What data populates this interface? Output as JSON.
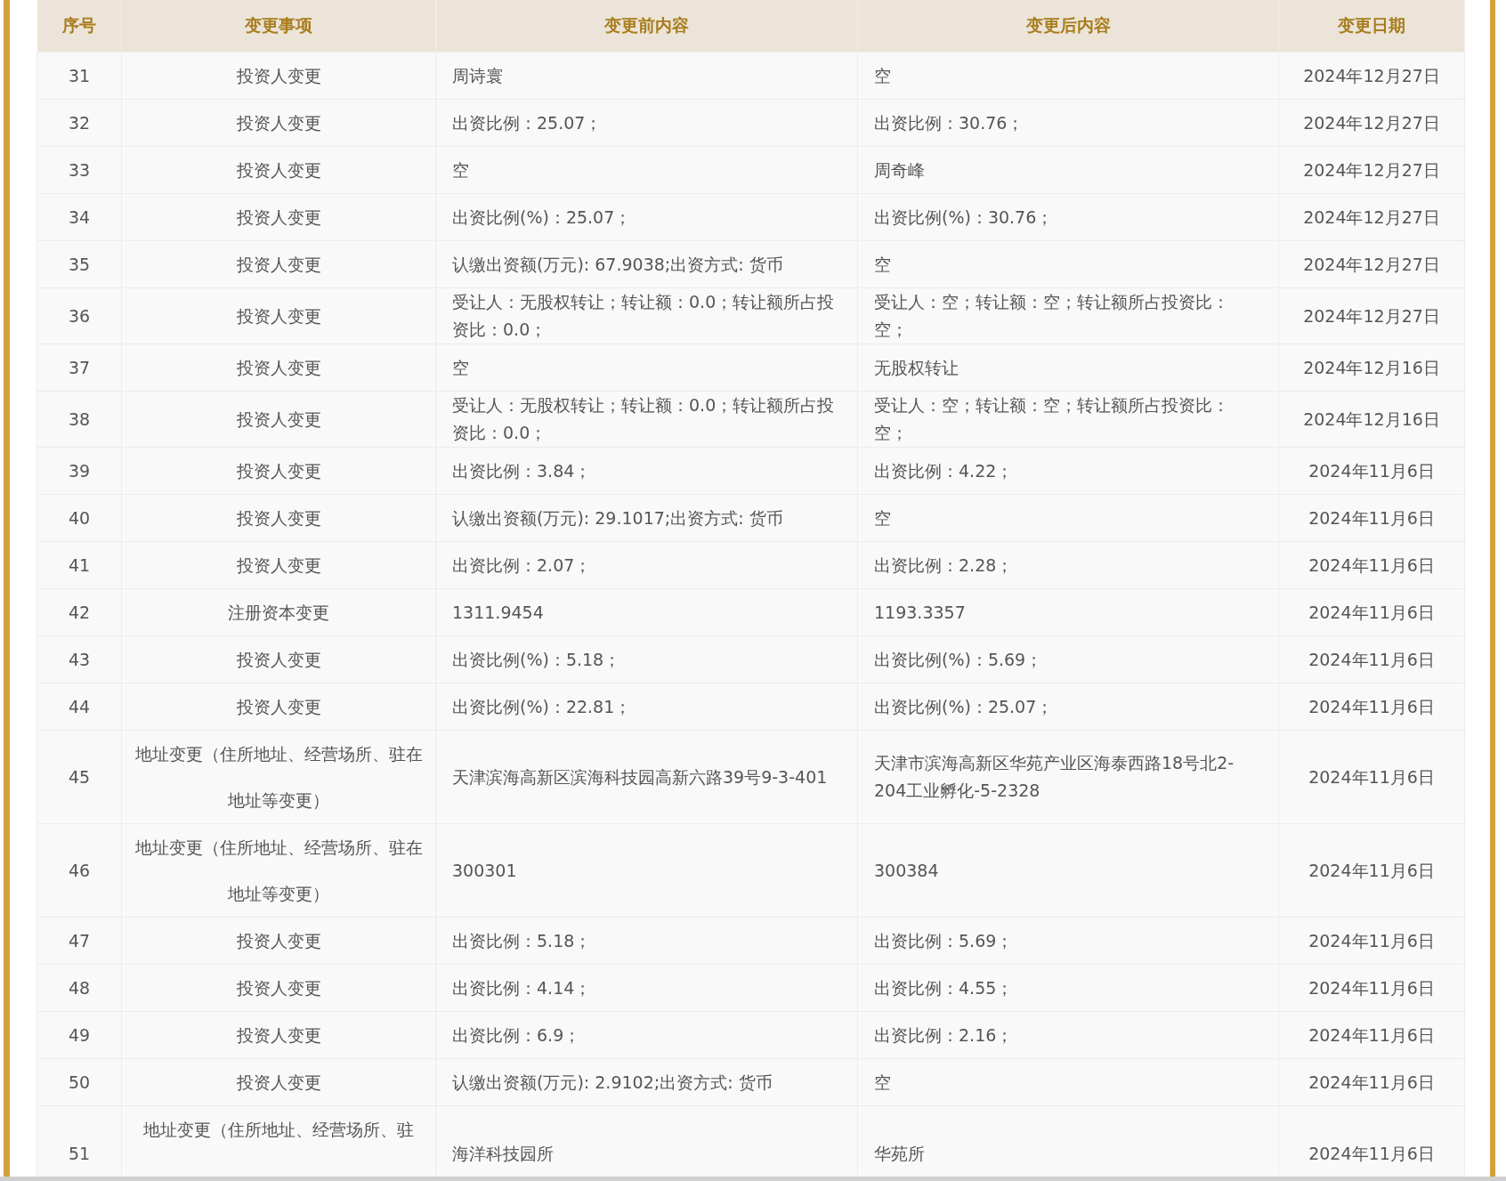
{
  "table": {
    "columns": [
      "序号",
      "变更事项",
      "变更前内容",
      "变更后内容",
      "变更日期"
    ],
    "rows": [
      {
        "no": "31",
        "item": "投资人变更",
        "before": "周诗寰",
        "after": "空",
        "date": "2024年12月27日"
      },
      {
        "no": "32",
        "item": "投资人变更",
        "before": "出资比例：25.07；",
        "after": "出资比例：30.76；",
        "date": "2024年12月27日"
      },
      {
        "no": "33",
        "item": "投资人变更",
        "before": "空",
        "after": "周奇峰",
        "date": "2024年12月27日"
      },
      {
        "no": "34",
        "item": "投资人变更",
        "before": "出资比例(%)：25.07；",
        "after": "出资比例(%)：30.76；",
        "date": "2024年12月27日"
      },
      {
        "no": "35",
        "item": "投资人变更",
        "before": "认缴出资额(万元): 67.9038;出资方式: 货币",
        "after": "空",
        "date": "2024年12月27日"
      },
      {
        "no": "36",
        "item": "投资人变更",
        "before": "受让人：无股权转让；转让额：0.0；转让额所占投资比：0.0；",
        "after": "受让人：空；转让额：空；转让额所占投资比：空；",
        "date": "2024年12月27日"
      },
      {
        "no": "37",
        "item": "投资人变更",
        "before": "空",
        "after": "无股权转让",
        "date": "2024年12月16日"
      },
      {
        "no": "38",
        "item": "投资人变更",
        "before": "受让人：无股权转让；转让额：0.0；转让额所占投资比：0.0；",
        "after": "受让人：空；转让额：空；转让额所占投资比：空；",
        "date": "2024年12月16日"
      },
      {
        "no": "39",
        "item": "投资人变更",
        "before": "出资比例：3.84；",
        "after": "出资比例：4.22；",
        "date": "2024年11月6日"
      },
      {
        "no": "40",
        "item": "投资人变更",
        "before": "认缴出资额(万元): 29.1017;出资方式: 货币",
        "after": "空",
        "date": "2024年11月6日"
      },
      {
        "no": "41",
        "item": "投资人变更",
        "before": "出资比例：2.07；",
        "after": "出资比例：2.28；",
        "date": "2024年11月6日"
      },
      {
        "no": "42",
        "item": "注册资本变更",
        "before": "1311.9454",
        "after": "1193.3357",
        "date": "2024年11月6日"
      },
      {
        "no": "43",
        "item": "投资人变更",
        "before": "出资比例(%)：5.18；",
        "after": "出资比例(%)：5.69；",
        "date": "2024年11月6日"
      },
      {
        "no": "44",
        "item": "投资人变更",
        "before": "出资比例(%)：22.81；",
        "after": "出资比例(%)：25.07；",
        "date": "2024年11月6日"
      },
      {
        "no": "45",
        "item": "地址变更（住所地址、经营场所、驻在地址等变更）",
        "before": "天津滨海高新区滨海科技园高新六路39号9-3-401",
        "after": "天津市滨海高新区华苑产业区海泰西路18号北2-204工业孵化-5-2328",
        "date": "2024年11月6日"
      },
      {
        "no": "46",
        "item": "地址变更（住所地址、经营场所、驻在地址等变更）",
        "before": "300301",
        "after": "300384",
        "date": "2024年11月6日"
      },
      {
        "no": "47",
        "item": "投资人变更",
        "before": "出资比例：5.18；",
        "after": "出资比例：5.69；",
        "date": "2024年11月6日"
      },
      {
        "no": "48",
        "item": "投资人变更",
        "before": "出资比例：4.14；",
        "after": "出资比例：4.55；",
        "date": "2024年11月6日"
      },
      {
        "no": "49",
        "item": "投资人变更",
        "before": "出资比例：6.9；",
        "after": "出资比例：2.16；",
        "date": "2024年11月6日"
      },
      {
        "no": "50",
        "item": "投资人变更",
        "before": "认缴出资额(万元): 2.9102;出资方式: 货币",
        "after": "空",
        "date": "2024年11月6日"
      },
      {
        "no": "51",
        "item": "地址变更（住所地址、经营场所、驻",
        "before": "海洋科技园所",
        "after": "华苑所",
        "date": "2024年11月6日"
      }
    ]
  }
}
